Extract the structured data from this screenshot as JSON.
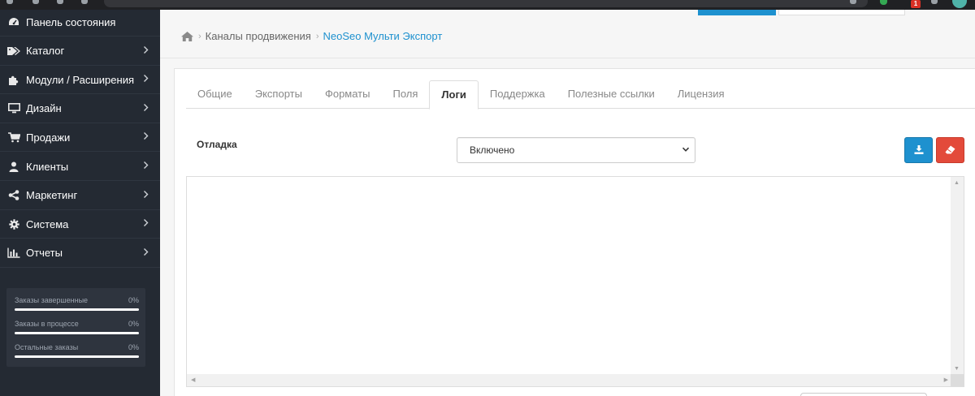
{
  "sidebar": {
    "items": [
      {
        "label": "Панель состояния",
        "icon": "dashboard-icon"
      },
      {
        "label": "Каталог",
        "icon": "tag-icon"
      },
      {
        "label": "Модули / Расширения",
        "icon": "puzzle-icon"
      },
      {
        "label": "Дизайн",
        "icon": "monitor-icon"
      },
      {
        "label": "Продажи",
        "icon": "cart-icon"
      },
      {
        "label": "Клиенты",
        "icon": "user-icon"
      },
      {
        "label": "Маркетинг",
        "icon": "share-icon"
      },
      {
        "label": "Система",
        "icon": "gear-icon"
      },
      {
        "label": "Отчеты",
        "icon": "bar-chart-icon"
      }
    ],
    "stats": [
      {
        "label": "Заказы завершенные",
        "value": "0%",
        "progress": 0
      },
      {
        "label": "Заказы в процессе",
        "value": "0%",
        "progress": 0
      },
      {
        "label": "Остальные заказы",
        "value": "0%",
        "progress": 0
      }
    ]
  },
  "breadcrumb": {
    "items": [
      "Каналы продвижения",
      "NeoSeo Мульти Экспорт"
    ]
  },
  "tabs": [
    "Общие",
    "Экспорты",
    "Форматы",
    "Поля",
    "Логи",
    "Поддержка",
    "Полезные ссылки",
    "Лицензия"
  ],
  "active_tab": "Логи",
  "debug": {
    "label": "Отладка",
    "selected": "Включено"
  },
  "log": {
    "content": ""
  },
  "colors": {
    "sidebar_bg": "#242a33",
    "accent_blue": "#1e91cf",
    "danger_red": "#e34a3a"
  }
}
